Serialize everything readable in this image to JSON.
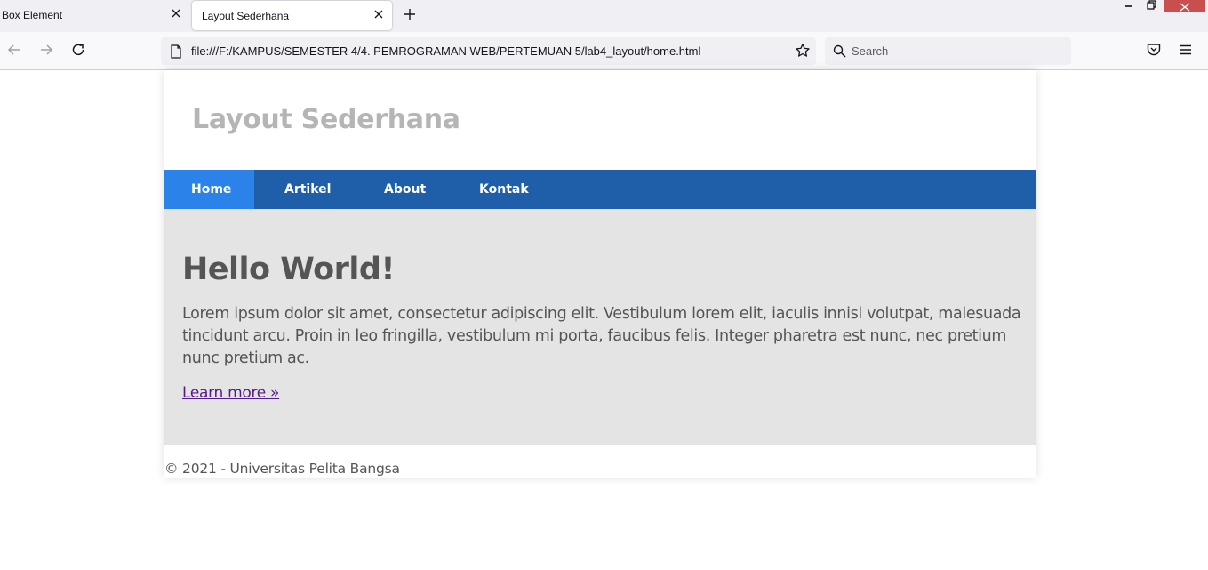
{
  "browser": {
    "tabs": [
      {
        "title": "Box Element",
        "active": false
      },
      {
        "title": "Layout Sederhana",
        "active": true
      }
    ],
    "url": "file:///F:/KAMPUS/SEMESTER 4/4. PEMROGRAMAN WEB/PERTEMUAN 5/lab4_layout/home.html",
    "search_placeholder": "Search"
  },
  "site": {
    "title": "Layout Sederhana",
    "nav": [
      {
        "label": "Home",
        "active": true
      },
      {
        "label": "Artikel",
        "active": false
      },
      {
        "label": "About",
        "active": false
      },
      {
        "label": "Kontak",
        "active": false
      }
    ],
    "hero": {
      "heading": "Hello World!",
      "paragraph": "Lorem ipsum dolor sit amet, consectetur adipiscing elit. Vestibulum lorem elit, iaculis innisl volutpat, malesuada tincidunt arcu. Proin in leo fringilla, vestibulum mi porta, faucibus felis. Integer pharetra est nunc, nec pretium nunc pretium ac.",
      "link": "Learn more »"
    },
    "footer": "© 2021 - Universitas Pelita Bangsa"
  },
  "colors": {
    "nav_bg": "#1f5faa",
    "nav_active": "#2b83ea",
    "hero_bg": "#e4e4e4",
    "title": "#b5b5b5",
    "window_close": "#c94f4f"
  }
}
